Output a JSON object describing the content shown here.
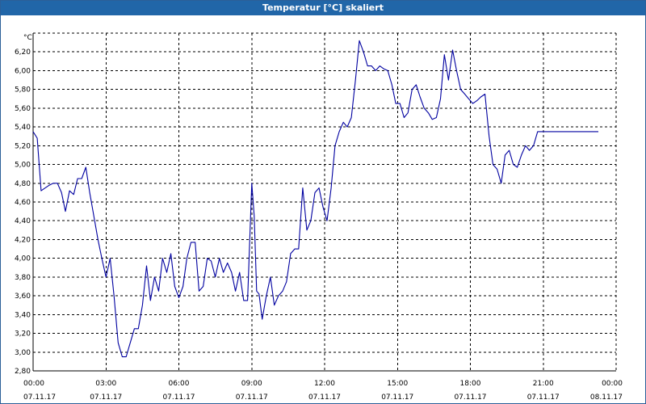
{
  "window": {
    "title": "Temperatur [°C] skaliert"
  },
  "colors": {
    "title_bar": "#2166a8",
    "series": "#0000a0",
    "grid": "#000000"
  },
  "chart_data": {
    "type": "line",
    "title": "Temperatur [°C] skaliert",
    "ylabel": "°C",
    "xlabel": "",
    "ylim": [
      2.8,
      6.4
    ],
    "xlim_hours": [
      0,
      24
    ],
    "grid": true,
    "grid_style": "dashed",
    "legend": "none",
    "y_ticks": [
      "2,80",
      "3,00",
      "3,20",
      "3,40",
      "3,60",
      "3,80",
      "4,00",
      "4,20",
      "4,40",
      "4,60",
      "4,80",
      "5,00",
      "5,20",
      "5,40",
      "5,60",
      "5,80",
      "6,00",
      "6,20"
    ],
    "x_ticks": [
      {
        "time": "00:00",
        "date": "07.11.17"
      },
      {
        "time": "03:00",
        "date": "07.11.17"
      },
      {
        "time": "06:00",
        "date": "07.11.17"
      },
      {
        "time": "09:00",
        "date": "07.11.17"
      },
      {
        "time": "12:00",
        "date": "07.11.17"
      },
      {
        "time": "15:00",
        "date": "07.11.17"
      },
      {
        "time": "18:00",
        "date": "07.11.17"
      },
      {
        "time": "21:00",
        "date": "07.11.17"
      },
      {
        "time": "00:00",
        "date": "08.11.17"
      }
    ],
    "series": [
      {
        "x_hours": [
          0.0,
          0.17,
          0.33,
          0.5,
          0.67,
          0.83,
          1.0,
          1.17,
          1.33,
          1.5,
          1.67,
          1.83,
          2.0,
          2.17,
          2.33,
          2.5,
          2.67,
          2.83,
          3.0,
          3.17,
          3.33,
          3.5,
          3.67,
          3.83,
          4.0,
          4.17,
          4.33,
          4.5,
          4.67,
          4.83,
          5.0,
          5.17,
          5.33,
          5.5,
          5.67,
          5.83,
          6.0,
          6.17,
          6.33,
          6.5,
          6.67,
          6.83,
          7.0,
          7.17,
          7.33,
          7.5,
          7.67,
          7.83,
          8.0,
          8.17,
          8.33,
          8.5,
          8.67,
          8.83,
          9.0,
          9.1,
          9.2,
          9.3,
          9.43,
          9.6,
          9.77,
          9.93,
          10.1,
          10.27,
          10.43,
          10.6,
          10.77,
          10.93,
          11.1,
          11.27,
          11.43,
          11.6,
          11.77,
          11.93,
          12.1,
          12.27,
          12.43,
          12.6,
          12.77,
          12.93,
          13.1,
          13.27,
          13.43,
          13.6,
          13.77,
          13.93,
          14.1,
          14.27,
          14.43,
          14.6,
          14.77,
          14.93,
          15.1,
          15.27,
          15.43,
          15.6,
          15.77,
          15.93,
          16.1,
          16.27,
          16.43,
          16.6,
          16.77,
          16.93,
          17.1,
          17.27,
          17.43,
          17.6,
          17.77,
          17.93,
          18.1,
          18.27,
          18.43,
          18.6,
          18.77,
          18.93,
          19.1,
          19.27,
          19.43,
          19.6,
          19.77,
          19.93,
          20.1,
          20.27,
          20.43,
          20.6,
          20.77,
          20.93,
          21.1,
          21.27,
          21.43,
          21.6,
          21.77,
          21.93,
          22.1,
          22.27,
          22.43,
          22.6,
          22.77,
          22.93,
          23.1,
          23.27,
          23.43,
          23.6,
          23.77,
          23.93
        ],
        "values": [
          5.35,
          5.28,
          4.72,
          4.75,
          4.78,
          4.8,
          4.8,
          4.7,
          4.5,
          4.72,
          4.68,
          4.85,
          4.85,
          4.97,
          4.7,
          4.45,
          4.2,
          4.0,
          3.8,
          4.0,
          3.6,
          3.1,
          2.95,
          2.95,
          3.1,
          3.25,
          3.25,
          3.5,
          3.92,
          3.55,
          3.8,
          3.65,
          4.0,
          3.85,
          4.05,
          3.7,
          3.58,
          3.7,
          4.0,
          4.17,
          4.17,
          3.65,
          3.7,
          4.0,
          3.97,
          3.8,
          4.0,
          3.85,
          3.95,
          3.85,
          3.65,
          3.85,
          3.55,
          3.55,
          4.8,
          4.45,
          3.65,
          3.62,
          3.35,
          3.6,
          3.8,
          3.5,
          3.6,
          3.65,
          3.75,
          4.05,
          4.1,
          4.1,
          4.75,
          4.3,
          4.4,
          4.7,
          4.75,
          4.55,
          4.4,
          4.75,
          5.2,
          5.35,
          5.45,
          5.4,
          5.5,
          5.9,
          6.32,
          6.2,
          6.05,
          6.05,
          6.0,
          6.05,
          6.02,
          6.0,
          5.85,
          5.65,
          5.65,
          5.5,
          5.55,
          5.8,
          5.85,
          5.72,
          5.6,
          5.55,
          5.48,
          5.5,
          5.7,
          6.17,
          5.9,
          6.22,
          6.0,
          5.8,
          5.75,
          5.7,
          5.65,
          5.68,
          5.72,
          5.75,
          5.3,
          5.0,
          4.95,
          4.8,
          5.1,
          5.15,
          5.0,
          4.97,
          5.1,
          5.2,
          5.15,
          5.2,
          5.35,
          5.35,
          5.35,
          5.35,
          5.35,
          5.35,
          5.35,
          5.35,
          5.35,
          5.35,
          5.35,
          5.35,
          5.35,
          5.35,
          5.35,
          5.35
        ]
      }
    ]
  }
}
